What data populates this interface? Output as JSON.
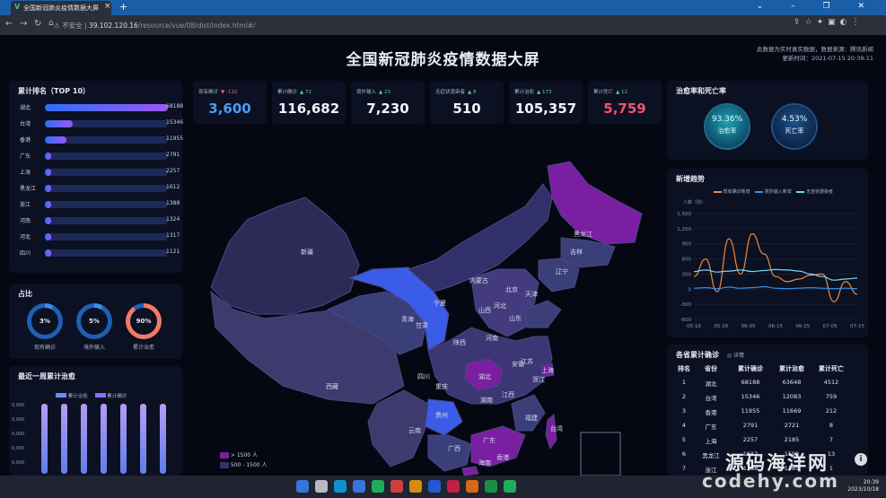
{
  "browser": {
    "tab_title": "全国新冠肺炎疫情数据大屏",
    "tab_icon": "V",
    "new_tab": "+",
    "window_controls": "⌄ – ❐ ✕",
    "security_label": "不安全",
    "url_host": "39.102.120.16",
    "url_path": "/resource/vue/08/dist/index.html#/"
  },
  "header": {
    "title": "全国新冠肺炎疫情数据大屏",
    "note_line1": "此数据为实时真实数据，数据来源：腾讯新闻",
    "note_line2": "更新时间：2021-07-15 20:39:11"
  },
  "ranking": {
    "title": "累计排名（TOP 10）",
    "max": 68188,
    "items": [
      {
        "name": "湖北",
        "value": 68188
      },
      {
        "name": "台湾",
        "value": 15346
      },
      {
        "name": "香港",
        "value": 11955
      },
      {
        "name": "广东",
        "value": 2791
      },
      {
        "name": "上海",
        "value": 2257
      },
      {
        "name": "黑龙江",
        "value": 1612
      },
      {
        "name": "浙江",
        "value": 1388
      },
      {
        "name": "河南",
        "value": 1324
      },
      {
        "name": "河北",
        "value": 1317
      },
      {
        "name": "四川",
        "value": 1121
      }
    ]
  },
  "ratio": {
    "title": "占比",
    "items": [
      {
        "value": "3%",
        "label": "现有确诊",
        "pct": 3,
        "color": "#3a8ee6"
      },
      {
        "value": "5%",
        "label": "境外输入",
        "pct": 5,
        "color": "#3a8ee6"
      },
      {
        "value": "90%",
        "label": "累计治愈",
        "pct": 90,
        "color": "#f07a6a"
      }
    ]
  },
  "weekly": {
    "title": "最近一周累计治愈",
    "legend": [
      "累计治愈",
      "累计确诊"
    ],
    "ylabels": [
      "0,000",
      "0,000",
      "0,000",
      "0,000",
      "0,000"
    ]
  },
  "kpis": [
    {
      "label": "现有确诊",
      "delta": "-110",
      "dir": "down",
      "value": "3,600",
      "color": "#4a9df8",
      "dcolor": "#f56c6c"
    },
    {
      "label": "累计确诊",
      "delta": "72",
      "dir": "up",
      "value": "116,682",
      "color": "#f1f4fb",
      "dcolor": "#5fd38d"
    },
    {
      "label": "境外输入",
      "delta": "23",
      "dir": "up",
      "value": "7,230",
      "color": "#f1f4fb",
      "dcolor": "#5fd38d"
    },
    {
      "label": "无症状感染者",
      "delta": "8",
      "dir": "up",
      "value": "510",
      "color": "#f1f4fb",
      "dcolor": "#5fd38d"
    },
    {
      "label": "累计治愈",
      "delta": "173",
      "dir": "up",
      "value": "105,357",
      "color": "#f1f4fb",
      "dcolor": "#5fd38d"
    },
    {
      "label": "累计死亡",
      "delta": "12",
      "dir": "up",
      "value": "5,759",
      "color": "#f0546a",
      "dcolor": "#5fd38d"
    }
  ],
  "map": {
    "legend": [
      "> 1500 人",
      "500 - 1500 人"
    ],
    "legend_colors": [
      "#7a1fa2",
      "#3a2f6b"
    ],
    "provinces": [
      "新疆",
      "西藏",
      "青海",
      "甘肃",
      "宁夏",
      "内蒙古",
      "黑龙江",
      "吉林",
      "辽宁",
      "北京",
      "天津",
      "河北",
      "山西",
      "山东",
      "陕西",
      "河南",
      "四川",
      "重庆",
      "湖北",
      "安徽",
      "江苏",
      "上海",
      "浙江",
      "湖南",
      "江西",
      "贵州",
      "云南",
      "广西",
      "广东",
      "福建",
      "海南",
      "台湾",
      "香港"
    ]
  },
  "rates": {
    "title": "治愈率和死亡率",
    "cure_value": "93.36%",
    "cure_label": "治愈率",
    "death_value": "4.53%",
    "death_label": "死亡率"
  },
  "trend": {
    "title": "新增趋势",
    "unit": "人数（例）",
    "legend": [
      "现有确诊新增",
      "境外输入新增",
      "无症状感染者"
    ],
    "colors": [
      "#f08a3c",
      "#3a8ee6",
      "#7bd3f2"
    ]
  },
  "chart_data": {
    "type": "line",
    "title": "新增趋势",
    "ylabel": "人数（例）",
    "ylim": [
      -600,
      1500
    ],
    "yticks": [
      "1,500",
      "1,200",
      "900",
      "600",
      "300",
      "0",
      "-300",
      "-600"
    ],
    "xticks": [
      "05-16",
      "05-26",
      "06-05",
      "06-15",
      "06-25",
      "07-05",
      "07-15"
    ],
    "series": [
      {
        "name": "现有确诊新增",
        "values": [
          250,
          600,
          -50,
          1000,
          300,
          1100,
          700,
          250,
          150,
          200,
          280,
          300,
          -250,
          150,
          -100
        ]
      },
      {
        "name": "境外输入新增",
        "values": [
          20,
          30,
          10,
          40,
          20,
          30,
          50,
          20,
          10,
          20,
          30,
          20,
          10,
          20,
          10
        ]
      },
      {
        "name": "无症状感染者",
        "values": [
          350,
          380,
          340,
          360,
          380,
          350,
          370,
          390,
          380,
          360,
          300,
          250,
          180,
          200,
          220
        ]
      }
    ]
  },
  "table": {
    "title": "各省累计确诊",
    "detail": "详情",
    "headers": [
      "排名",
      "省份",
      "累计确诊",
      "累计治愈",
      "累计死亡"
    ],
    "rows": [
      [
        "1",
        "湖北",
        "68188",
        "63648",
        "4512"
      ],
      [
        "2",
        "台湾",
        "15346",
        "12083",
        "759"
      ],
      [
        "3",
        "香港",
        "11955",
        "11669",
        "212"
      ],
      [
        "4",
        "广东",
        "2791",
        "2721",
        "8"
      ],
      [
        "5",
        "上海",
        "2257",
        "2185",
        "7"
      ],
      [
        "6",
        "黑龙江",
        "1612",
        "1598",
        "13"
      ],
      [
        "7",
        "浙江",
        "1388",
        "1385",
        "1"
      ]
    ]
  },
  "watermark": {
    "line1": "源码海洋网",
    "line2": "codehy.com"
  },
  "clock": {
    "time": "20:39",
    "date": "2023/10/18"
  }
}
